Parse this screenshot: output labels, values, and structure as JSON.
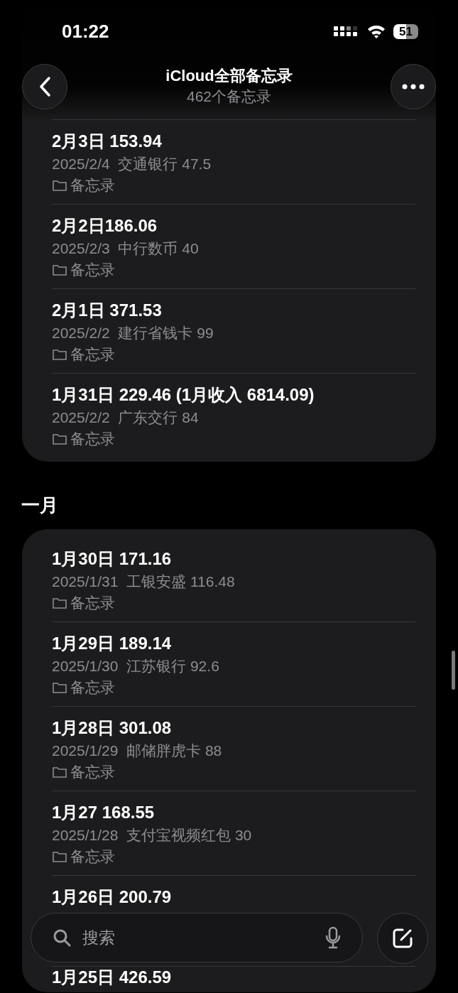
{
  "status_bar": {
    "time": "01:22",
    "battery": "51"
  },
  "nav": {
    "title": "iCloud全部备忘录",
    "subtitle": "462个备忘录"
  },
  "sections": [
    {
      "notes": [
        {
          "title": "2月3日 153.94",
          "date": "2025/2/4",
          "preview": "交通银行 47.5",
          "folder": "备忘录"
        },
        {
          "title": "2月2日186.06",
          "date": "2025/2/3",
          "preview": "中行数币 40",
          "folder": "备忘录"
        },
        {
          "title": "2月1日 371.53",
          "date": "2025/2/2",
          "preview": "建行省钱卡 99",
          "folder": "备忘录"
        },
        {
          "title": "1月31日 229.46 (1月收入 6814.09)",
          "date": "2025/2/2",
          "preview": "广东交行 84",
          "folder": "备忘录"
        }
      ]
    },
    {
      "title": "一月",
      "notes": [
        {
          "title": "1月30日 171.16",
          "date": "2025/1/31",
          "preview": "工银安盛 116.48",
          "folder": "备忘录"
        },
        {
          "title": "1月29日 189.14",
          "date": "2025/1/30",
          "preview": "江苏银行 92.6",
          "folder": "备忘录"
        },
        {
          "title": "1月28日 301.08",
          "date": "2025/1/29",
          "preview": "邮储胖虎卡 88",
          "folder": "备忘录"
        },
        {
          "title": "1月27 168.55",
          "date": "2025/1/28",
          "preview": "支付宝视频红包 30",
          "folder": "备忘录"
        },
        {
          "title": "1月26日 200.79"
        },
        {
          "title": "1月25日 426.59"
        }
      ]
    }
  ],
  "search": {
    "placeholder": "搜索"
  }
}
